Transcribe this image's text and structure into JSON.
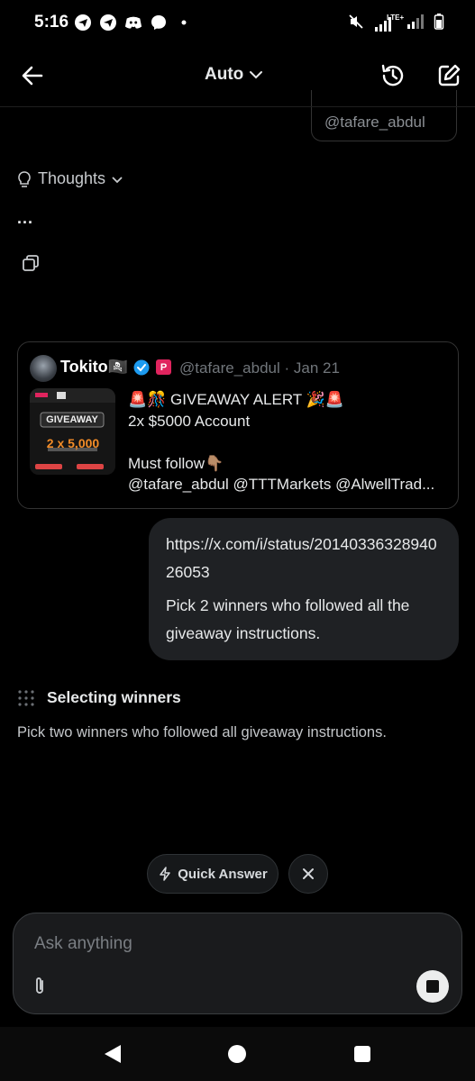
{
  "status_bar": {
    "time": "5:16",
    "left_icons": [
      "telegram-icon",
      "telegram-icon",
      "discord-icon",
      "messenger-icon",
      "dot-icon"
    ],
    "right_icons": [
      "mute-icon",
      "signal-lte-icon",
      "signal-icon",
      "battery-icon"
    ],
    "network_label": "LTE+"
  },
  "top_bar": {
    "mode_label": "Auto"
  },
  "previous_message": {
    "handle_fragment": "@tafare_abdul"
  },
  "thoughts": {
    "label": "Thoughts",
    "ellipsis": "..."
  },
  "tweet": {
    "author": "Tokito🏴‍☠️",
    "meta": "@tafare_abdul · Jan 21",
    "brand_letter": "P",
    "text": "🚨🎊 GIVEAWAY ALERT 🎉🚨\n2x $5000 Account\n\nMust follow👇🏽\n@tafare_abdul @TTTMarkets @AlwellTrad...",
    "thumbnail": {
      "title": "GIVEAWAY",
      "amount": "2 x 5,000"
    }
  },
  "user_message": {
    "link": "https://x.com/i/status/2014033632894026053",
    "text": "Pick 2 winners who followed all the giveaway instructions."
  },
  "task": {
    "title": "Selecting winners",
    "description": "Pick two winners who followed all giveaway instructions."
  },
  "quick_answer": {
    "label": "Quick Answer"
  },
  "composer": {
    "placeholder": "Ask anything"
  },
  "colors": {
    "background": "#000000",
    "bubble": "#1f2124",
    "verified": "#1d9bf0",
    "brand_badge": "#e0245e"
  }
}
